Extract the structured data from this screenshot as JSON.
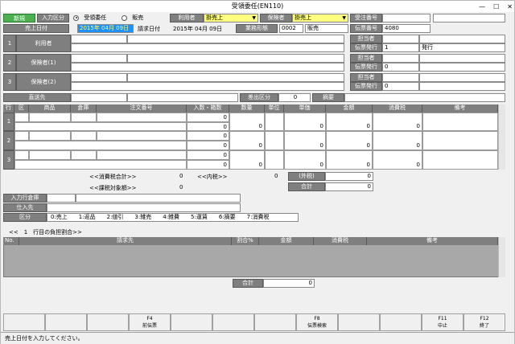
{
  "window": {
    "title": "受領委任(EN110)",
    "minimize": "—",
    "maximize": "☐",
    "close": "✕"
  },
  "header": {
    "mode": "新規",
    "input_kbn_label": "入力区分",
    "radio1": "受領委任",
    "radio2": "販売",
    "riyousha_label": "利用者",
    "riyousha_value": "掛売上",
    "hokensha_label": "保険者",
    "hokensha_value": "掛売上",
    "juchu_label": "受注番号",
    "uriage_date_label": "売上日付",
    "uriage_date_value": "2015年 04月 09日",
    "seikyu_date_label": "請求日付",
    "seikyu_date_value": "2015年 04月 09日",
    "gyomu_label": "業務形態",
    "gyomu_code": "0002",
    "gyomu_name": "販売",
    "denpyo_label": "伝票番号",
    "denpyo_value": "4080"
  },
  "parties": {
    "rows": [
      {
        "no": "1",
        "label": "利用者"
      },
      {
        "no": "2",
        "label": "保険者(1)"
      },
      {
        "no": "3",
        "label": "保険者(2)"
      }
    ],
    "tantou_label": "担当者",
    "denpyo_hakko_label": "伝票発行",
    "hakko_values": [
      "1",
      "0",
      "0"
    ],
    "hakko_text": "発行",
    "chokusou_label": "直送先",
    "sashidashi_label": "差出区分",
    "sashidashi_value": "0",
    "tekiyo_label": "摘要"
  },
  "grid": {
    "headers": {
      "gyo": "行",
      "ku": "区",
      "shohin": "商品",
      "soko": "倉庫",
      "chumon": "注文番号",
      "irisu": "入数・箱数",
      "suryo": "数量",
      "tani": "単位",
      "tanka": "単価",
      "kingaku": "金額",
      "shohizei": "消費税",
      "biko": "備考"
    },
    "rows": [
      {
        "no": "1",
        "irisu": [
          "0",
          "0"
        ],
        "suryo": "0",
        "tanka": "0",
        "kingaku": "0",
        "zei": "0"
      },
      {
        "no": "2",
        "irisu": [
          "0",
          "0"
        ],
        "suryo": "0",
        "tanka": "0",
        "kingaku": "0",
        "zei": "0"
      },
      {
        "no": "3",
        "irisu": [
          "0",
          "0"
        ],
        "suryo": "0",
        "tanka": "0",
        "kingaku": "0",
        "zei": "0"
      }
    ]
  },
  "totals": {
    "shohizei_total_label": "<<消費税合計>>",
    "shohizei_total_value": "0",
    "uchizei_label": "<<内税>>",
    "uchizei_value": "0",
    "kazei_label": "<<課税対象額>>",
    "kazei_value": "0",
    "sotozei_label": "(外税)",
    "sotozei_value": "0",
    "gokei_label": "合計",
    "gokei_value": "0"
  },
  "lower": {
    "nyuryoku_soko_label": "入力行倉庫",
    "shiiresaki_label": "仕入先",
    "kubun_label": "区分",
    "kubun_options": "0:売上　　1:返品　　2:値引　　3:雑売　　4:雑費　　5:運賃　　6:摘要　　7:消費税"
  },
  "burden": {
    "title": "<<　1　行目の負担割合>>",
    "headers": {
      "no": "No.",
      "seikyusaki": "請求先",
      "wariai": "割合%",
      "kingaku": "金額",
      "zei": "消費税",
      "biko": "備考"
    },
    "total_label": "合計",
    "total_value": "0"
  },
  "fkeys": [
    {
      "key": "",
      "label": ""
    },
    {
      "key": "",
      "label": ""
    },
    {
      "key": "",
      "label": ""
    },
    {
      "key": "F4",
      "label": "前伝票"
    },
    {
      "key": "",
      "label": ""
    },
    {
      "key": "",
      "label": ""
    },
    {
      "key": "",
      "label": ""
    },
    {
      "key": "F8",
      "label": "伝票検索"
    },
    {
      "key": "",
      "label": ""
    },
    {
      "key": "",
      "label": ""
    },
    {
      "key": "F11",
      "label": "中止"
    },
    {
      "key": "F12",
      "label": "終了"
    }
  ],
  "status": "売上日付を入力してください。"
}
